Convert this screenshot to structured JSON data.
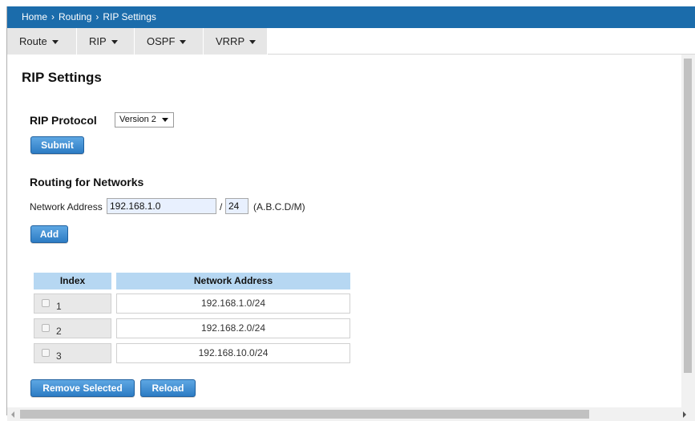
{
  "breadcrumb": {
    "items": [
      "Home",
      "Routing",
      "RIP Settings"
    ],
    "separator": "›"
  },
  "menu": [
    {
      "label": "Route"
    },
    {
      "label": "RIP"
    },
    {
      "label": "OSPF"
    },
    {
      "label": "VRRP"
    }
  ],
  "page": {
    "title": "RIP Settings"
  },
  "rip_protocol": {
    "label": "RIP Protocol",
    "selected": "Version 2",
    "submit_label": "Submit"
  },
  "routing": {
    "section_label": "Routing for Networks",
    "network_address_label": "Network Address",
    "address_value": "192.168.1.0",
    "slash": "/",
    "mask_value": "24",
    "format_hint": "(A.B.C.D/M)",
    "add_label": "Add"
  },
  "table": {
    "headers": {
      "index": "Index",
      "address": "Network Address"
    },
    "rows": [
      {
        "index": "1",
        "address": "192.168.1.0/24",
        "checked": false
      },
      {
        "index": "2",
        "address": "192.168.2.0/24",
        "checked": false
      },
      {
        "index": "3",
        "address": "192.168.10.0/24",
        "checked": false
      }
    ]
  },
  "actions": {
    "remove_label": "Remove Selected",
    "reload_label": "Reload"
  },
  "colors": {
    "breadcrumb_bg": "#1b6cab",
    "header_bg": "#b6d7f2",
    "button_bg": "#2d7cc4",
    "input_bg": "#e8f0fe"
  },
  "icons": [
    "caret-down-icon",
    "select-arrow-icon",
    "checkbox-icon",
    "scroll-left-arrow-icon",
    "scroll-right-arrow-icon"
  ]
}
